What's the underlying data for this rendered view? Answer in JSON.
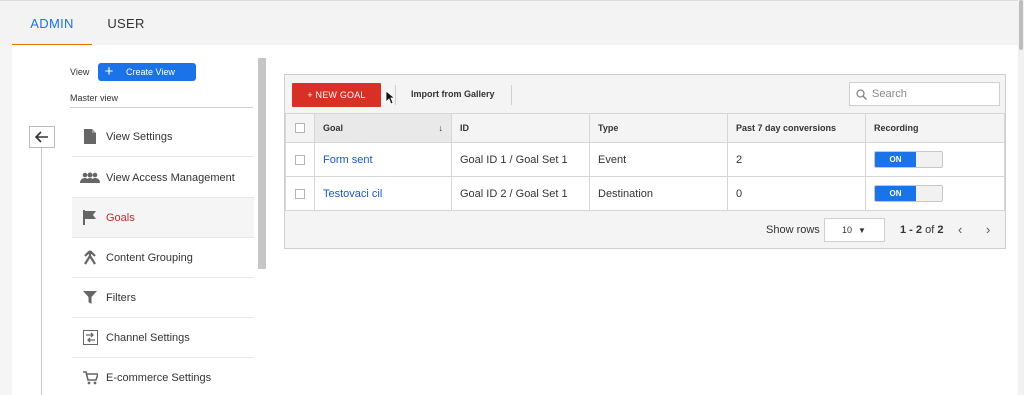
{
  "tabs": {
    "admin": "ADMIN",
    "user": "USER"
  },
  "left_panel": {
    "view_label": "View",
    "create_view_label": "Create View",
    "master_view": "Master view",
    "items": [
      {
        "label": "View Settings",
        "icon": "document-icon",
        "active": false
      },
      {
        "label": "View Access Management",
        "icon": "people-icon",
        "active": false
      },
      {
        "label": "Goals",
        "icon": "flag-icon",
        "active": true
      },
      {
        "label": "Content Grouping",
        "icon": "grouping-icon",
        "active": false
      },
      {
        "label": "Filters",
        "icon": "filter-icon",
        "active": false
      },
      {
        "label": "Channel Settings",
        "icon": "channel-icon",
        "active": false
      },
      {
        "label": "E-commerce Settings",
        "icon": "cart-icon",
        "active": false
      }
    ]
  },
  "toolbar": {
    "new_goal": "+ NEW GOAL",
    "import": "Import from Gallery",
    "search_placeholder": "Search"
  },
  "table": {
    "columns": [
      "Goal",
      "ID",
      "Type",
      "Past 7 day conversions",
      "Recording"
    ],
    "rows": [
      {
        "goal": "Form sent",
        "id": "Goal ID 1 / Goal Set 1",
        "type": "Event",
        "conversions": "2",
        "recording": "ON"
      },
      {
        "goal": "Testovaci cil",
        "id": "Goal ID 2 / Goal Set 1",
        "type": "Destination",
        "conversions": "0",
        "recording": "ON"
      }
    ]
  },
  "pagination": {
    "show_rows_label": "Show rows",
    "rows_value": "10",
    "range": "1 - 2",
    "of_label": "of",
    "total": "2"
  },
  "colors": {
    "accent": "#1a73e8",
    "danger": "#d93025",
    "tab_underline": "#e37400"
  }
}
